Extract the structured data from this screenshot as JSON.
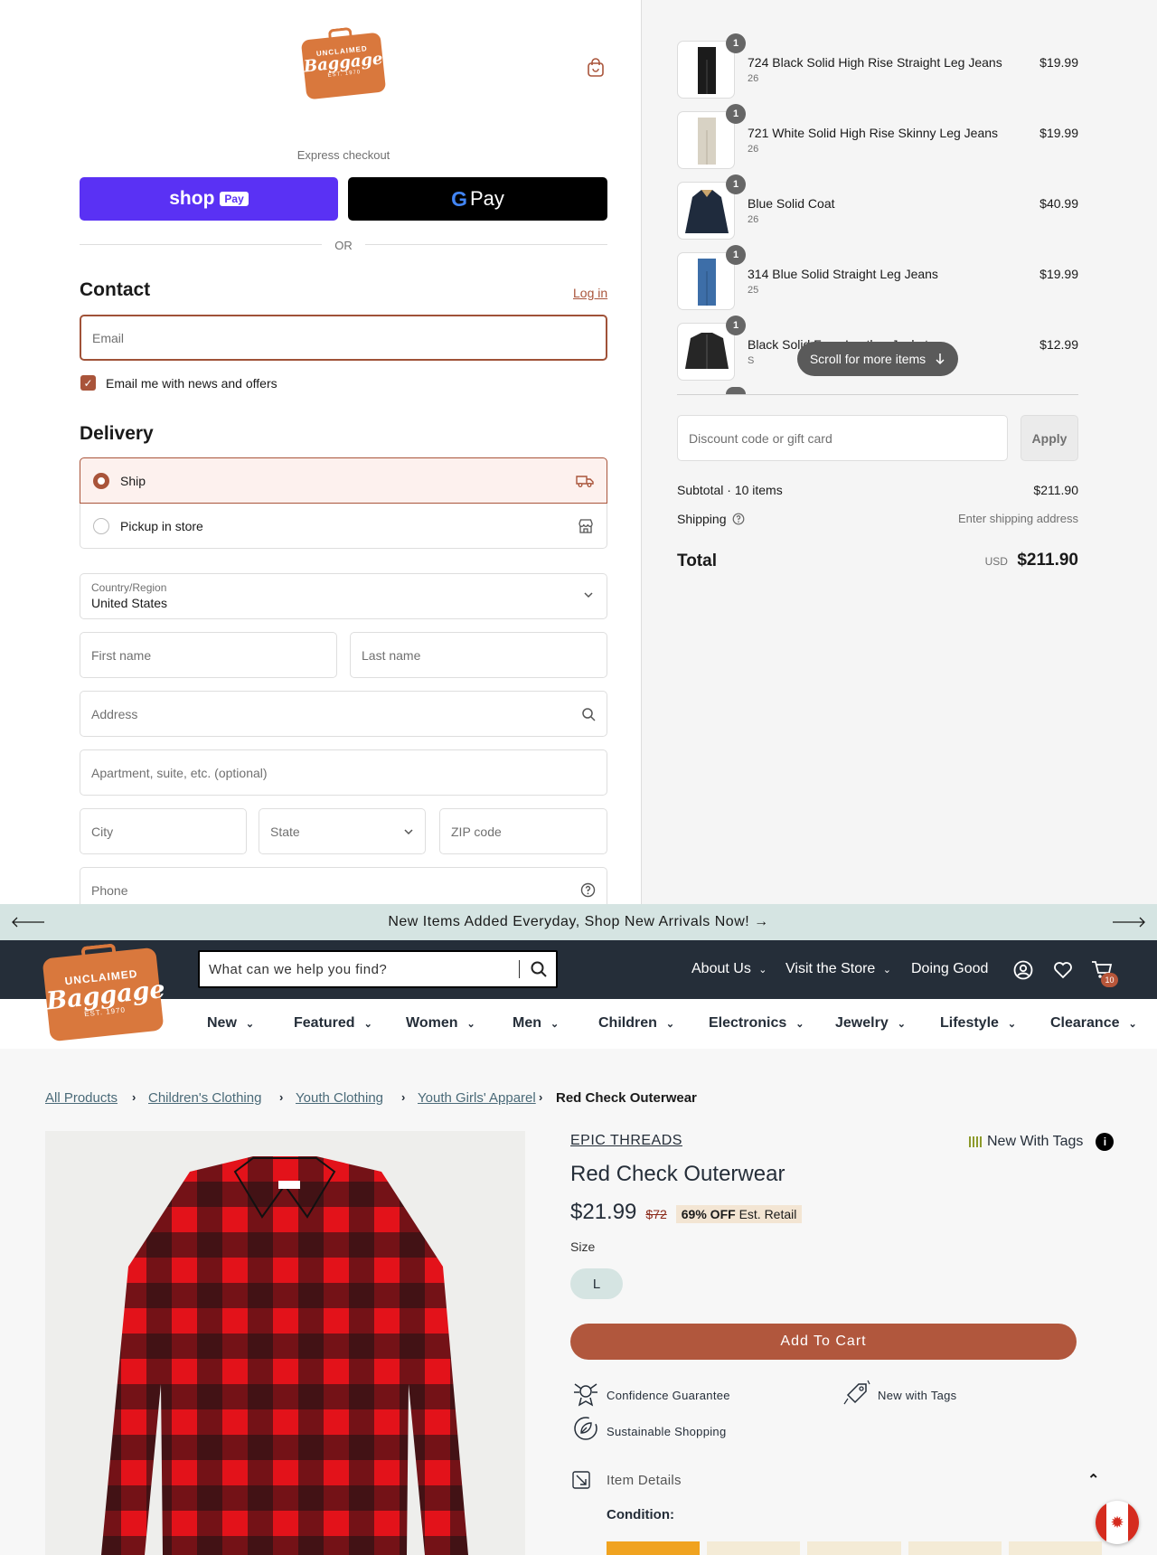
{
  "checkout": {
    "express_label": "Express checkout",
    "shop_pay": {
      "shop": "shop",
      "pay": "Pay"
    },
    "gpay": {
      "g": "G",
      "pay": "Pay"
    },
    "or": "OR",
    "contact": {
      "title": "Contact",
      "login": "Log in",
      "email_placeholder": "Email",
      "news_label": "Email me with news and offers",
      "news_checked": true
    },
    "delivery": {
      "title": "Delivery",
      "options": [
        {
          "label": "Ship",
          "selected": true
        },
        {
          "label": "Pickup in store",
          "selected": false
        }
      ]
    },
    "address_form": {
      "country_label": "Country/Region",
      "country_value": "United States",
      "first_name": "First name",
      "last_name": "Last name",
      "address": "Address",
      "apartment": "Apartment, suite, etc. (optional)",
      "city": "City",
      "state": "State",
      "zip": "ZIP code",
      "phone": "Phone"
    },
    "items": [
      {
        "name": "724 Black Solid High Rise Straight Leg Jeans",
        "size": "26",
        "price": "$19.99",
        "qty": "1",
        "thumb": "black-jeans"
      },
      {
        "name": "721 White Solid High Rise Skinny Leg Jeans",
        "size": "26",
        "price": "$19.99",
        "qty": "1",
        "thumb": "white-jeans"
      },
      {
        "name": "Blue Solid Coat",
        "size": "26",
        "price": "$40.99",
        "qty": "1",
        "thumb": "blue-coat"
      },
      {
        "name": "314 Blue Solid Straight Leg Jeans",
        "size": "25",
        "price": "$19.99",
        "qty": "1",
        "thumb": "blue-jeans"
      },
      {
        "name": "Black Solid Faux Leather Jacket",
        "size": "S",
        "price": "$12.99",
        "qty": "1",
        "thumb": "black-jacket"
      }
    ],
    "scroll_hint": "Scroll for more items",
    "discount_placeholder": "Discount code or gift card",
    "apply_label": "Apply",
    "subtotal_label": "Subtotal · 10 items",
    "subtotal_value": "$211.90",
    "shipping_label": "Shipping",
    "shipping_value": "Enter shipping address",
    "total_label": "Total",
    "total_currency": "USD",
    "total_value": "$211.90"
  },
  "store": {
    "banner": "New Items Added Everyday, Shop New Arrivals Now! →",
    "search_placeholder": "What can we help you find?",
    "nav": {
      "about": "About Us",
      "visit": "Visit the Store",
      "doing_good": "Doing Good",
      "cart_count": "10"
    },
    "categories": [
      "New",
      "Featured",
      "Women",
      "Men",
      "Children",
      "Electronics",
      "Jewelry",
      "Lifestyle",
      "Clearance"
    ],
    "breadcrumb": [
      "All Products",
      "Children's Clothing",
      "Youth Clothing",
      "Youth Girls' Apparel",
      "Red Check Outerwear"
    ],
    "product": {
      "brand": "EPIC THREADS",
      "condition_tag": "New With Tags",
      "title": "Red Check Outerwear",
      "price": "$21.99",
      "retail": "$72",
      "off": "69% OFF",
      "off_suffix": "Est. Retail",
      "size_label": "Size",
      "size_value": "L",
      "add_to_cart": "Add To Cart",
      "features": [
        "Confidence Guarantee",
        "New with Tags",
        "Sustainable Shopping"
      ],
      "details_label": "Item Details",
      "condition_label": "Condition:"
    }
  },
  "logo": {
    "line1": "UNCLAIMED",
    "line2": "Baggage",
    "line3": "EST. 1970"
  },
  "colors": {
    "accent": "#a9543a",
    "shop_pay": "#5a31f4",
    "nav_bg": "#252e39",
    "banner_bg": "#d5e4e2",
    "brand_orange": "#d9783d"
  }
}
